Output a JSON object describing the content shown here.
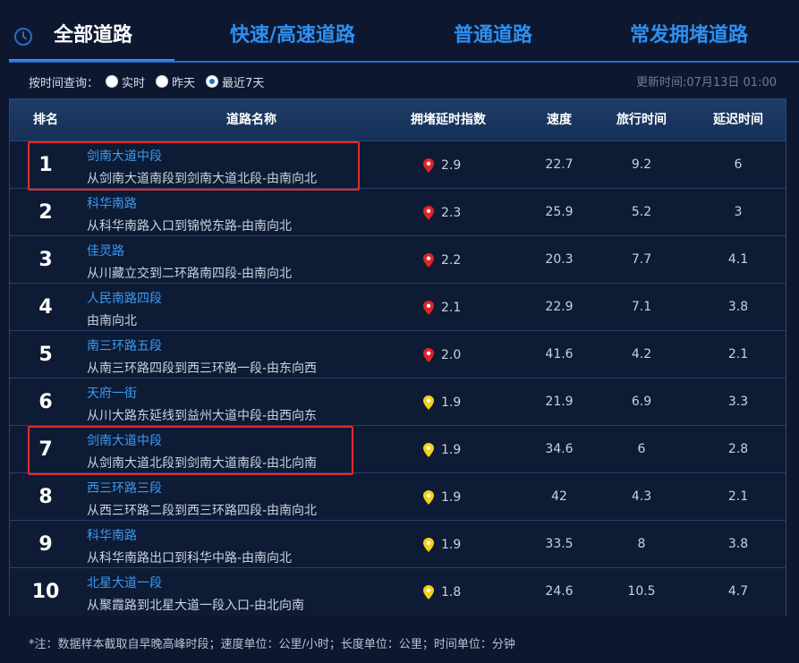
{
  "tabs": [
    {
      "label": "全部道路",
      "active": true
    },
    {
      "label": "快速/高速道路",
      "active": false
    },
    {
      "label": "普通道路",
      "active": false
    },
    {
      "label": "常发拥堵道路",
      "active": false
    }
  ],
  "filter": {
    "label": "按时间查询：",
    "options": [
      {
        "label": "实时",
        "checked": false
      },
      {
        "label": "昨天",
        "checked": false
      },
      {
        "label": "最近7天",
        "checked": true
      }
    ]
  },
  "update_time": "更新时间:07月13日 01:00",
  "table": {
    "headers": [
      "排名",
      "道路名称",
      "拥堵延时指数",
      "速度",
      "旅行时间",
      "延迟时间"
    ],
    "rows": [
      {
        "rank": "1",
        "name": "剑南大道中段",
        "desc": "从剑南大道南段到剑南大道北段-由南向北",
        "index": "2.9",
        "level": "red",
        "speed": "22.7",
        "travel": "9.2",
        "delay": "6",
        "highlighted": true
      },
      {
        "rank": "2",
        "name": "科华南路",
        "desc": "从科华南路入口到锦悦东路-由南向北",
        "index": "2.3",
        "level": "red",
        "speed": "25.9",
        "travel": "5.2",
        "delay": "3",
        "highlighted": false
      },
      {
        "rank": "3",
        "name": "佳灵路",
        "desc": "从川藏立交到二环路南四段-由南向北",
        "index": "2.2",
        "level": "red",
        "speed": "20.3",
        "travel": "7.7",
        "delay": "4.1",
        "highlighted": false
      },
      {
        "rank": "4",
        "name": "人民南路四段",
        "desc": "由南向北",
        "index": "2.1",
        "level": "red",
        "speed": "22.9",
        "travel": "7.1",
        "delay": "3.8",
        "highlighted": false
      },
      {
        "rank": "5",
        "name": "南三环路五段",
        "desc": "从南三环路四段到西三环路一段-由东向西",
        "index": "2.0",
        "level": "red",
        "speed": "41.6",
        "travel": "4.2",
        "delay": "2.1",
        "highlighted": false
      },
      {
        "rank": "6",
        "name": "天府一街",
        "desc": "从川大路东延线到益州大道中段-由西向东",
        "index": "1.9",
        "level": "yellow",
        "speed": "21.9",
        "travel": "6.9",
        "delay": "3.3",
        "highlighted": false
      },
      {
        "rank": "7",
        "name": "剑南大道中段",
        "desc": "从剑南大道北段到剑南大道南段-由北向南",
        "index": "1.9",
        "level": "yellow",
        "speed": "34.6",
        "travel": "6",
        "delay": "2.8",
        "highlighted": true
      },
      {
        "rank": "8",
        "name": "西三环路三段",
        "desc": "从西三环路二段到西三环路四段-由南向北",
        "index": "1.9",
        "level": "yellow",
        "speed": "42",
        "travel": "4.3",
        "delay": "2.1",
        "highlighted": false
      },
      {
        "rank": "9",
        "name": "科华南路",
        "desc": "从科华南路出口到科华中路-由南向北",
        "index": "1.9",
        "level": "yellow",
        "speed": "33.5",
        "travel": "8",
        "delay": "3.8",
        "highlighted": false
      },
      {
        "rank": "10",
        "name": "北星大道一段",
        "desc": "从聚霞路到北星大道一段入口-由北向南",
        "index": "1.8",
        "level": "yellow",
        "speed": "24.6",
        "travel": "10.5",
        "delay": "4.7",
        "highlighted": false
      }
    ]
  },
  "colors": {
    "red_pin": "#e02424",
    "yellow_pin": "#f2d21a",
    "link_blue": "#3a9bf4",
    "highlight": "#e32b2b"
  },
  "footnote": "*注：数据样本截取自早晚高峰时段；速度单位：公里/小时；长度单位：公里；时间单位：分钟"
}
